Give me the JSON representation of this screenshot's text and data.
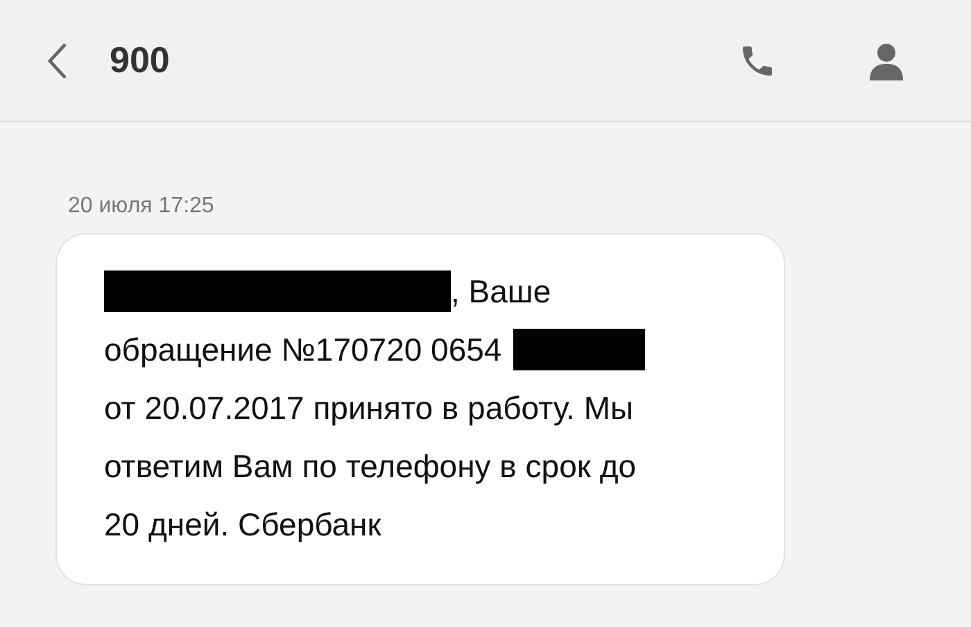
{
  "header": {
    "title": "900"
  },
  "messages": [
    {
      "date": "20 июля 17:25",
      "lines": [
        [
          {
            "kind": "redacted",
            "wide": true
          },
          {
            "kind": "text",
            "text": ", Ваше"
          }
        ],
        [
          {
            "kind": "text",
            "text": "обращение №170720 0654"
          },
          {
            "kind": "redacted",
            "wide": false
          }
        ],
        [
          {
            "kind": "text",
            "text": "от 20.07.2017 принято в работу. Мы"
          }
        ],
        [
          {
            "kind": "text",
            "text": "ответим Вам по телефону в срок до"
          }
        ],
        [
          {
            "kind": "text",
            "text": "20 дней. Сбербанк"
          }
        ]
      ]
    }
  ]
}
